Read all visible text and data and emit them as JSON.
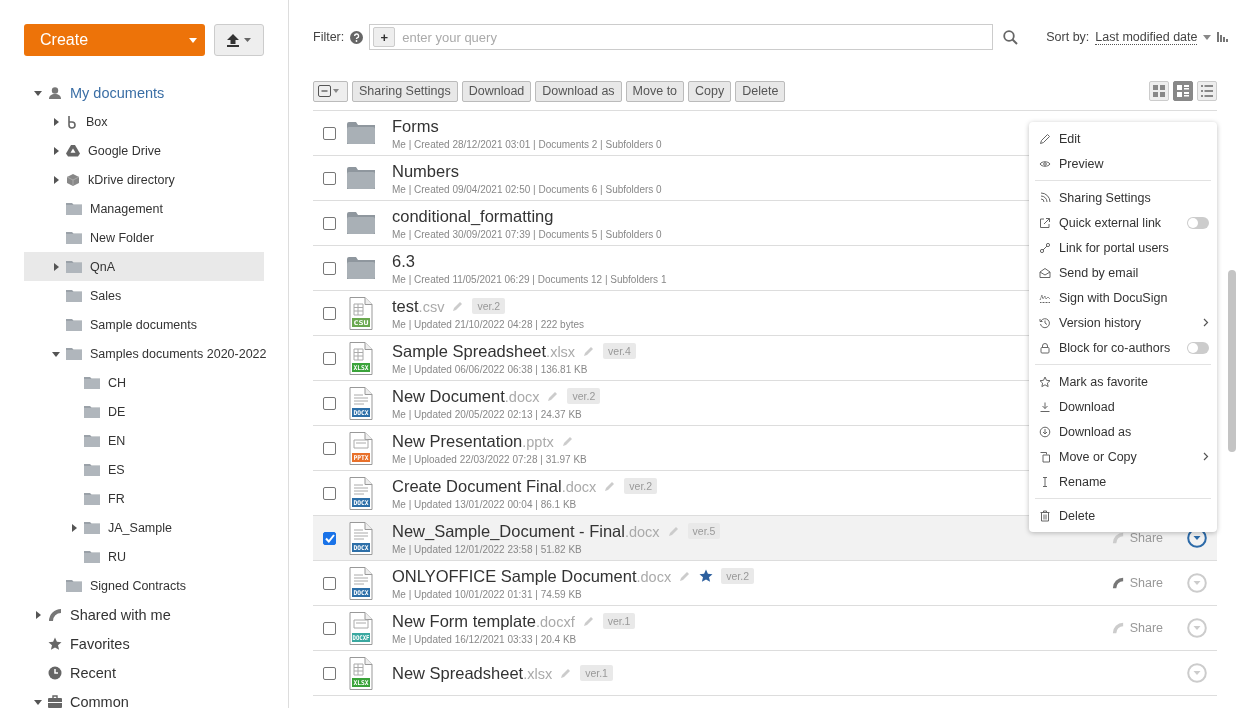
{
  "create_button": {
    "label": "Create"
  },
  "sidebar": {
    "tree": [
      {
        "label": "My documents",
        "kind": "user",
        "expanded": true,
        "selected": false,
        "children": [
          {
            "label": "Box",
            "kind": "box",
            "expanded": false,
            "selected": false
          },
          {
            "label": "Google Drive",
            "kind": "drive",
            "expanded": false,
            "selected": false
          },
          {
            "label": "kDrive directory",
            "kind": "cube",
            "expanded": false,
            "selected": false
          },
          {
            "label": "Management",
            "kind": "folder",
            "selected": false
          },
          {
            "label": "New Folder",
            "kind": "folder",
            "selected": false
          },
          {
            "label": "QnA",
            "kind": "folder",
            "expanded": false,
            "selected": true
          },
          {
            "label": "Sales",
            "kind": "folder",
            "selected": false
          },
          {
            "label": "Sample documents",
            "kind": "folder",
            "selected": false
          },
          {
            "label": "Samples documents 2020-2022",
            "kind": "folder",
            "expanded": true,
            "selected": false,
            "children": [
              {
                "label": "CH",
                "kind": "folder",
                "selected": false
              },
              {
                "label": "DE",
                "kind": "folder",
                "selected": false
              },
              {
                "label": "EN",
                "kind": "folder",
                "selected": false
              },
              {
                "label": "ES",
                "kind": "folder",
                "selected": false
              },
              {
                "label": "FR",
                "kind": "folder",
                "selected": false
              },
              {
                "label": "JA_Sample",
                "kind": "folder",
                "expanded": false,
                "selected": false
              },
              {
                "label": "RU",
                "kind": "folder",
                "selected": false
              }
            ]
          },
          {
            "label": "Signed Contracts",
            "kind": "folder",
            "selected": false
          }
        ]
      },
      {
        "label": "Shared with me",
        "kind": "shared",
        "expanded": false,
        "selected": false
      },
      {
        "label": "Favorites",
        "kind": "star",
        "selected": false
      },
      {
        "label": "Recent",
        "kind": "clock",
        "selected": false
      },
      {
        "label": "Common",
        "kind": "briefcase",
        "expanded": true,
        "selected": false
      }
    ]
  },
  "filter": {
    "label": "Filter:",
    "placeholder": "enter your query",
    "add": "+"
  },
  "sort": {
    "label": "Sort by:",
    "value": "Last modified date"
  },
  "toolbar": {
    "buttons": [
      "Sharing Settings",
      "Download",
      "Download as",
      "Move to",
      "Copy",
      "Delete"
    ]
  },
  "views": [
    {
      "kind": "tiles",
      "selected": false
    },
    {
      "kind": "compact",
      "selected": true
    },
    {
      "kind": "list",
      "selected": false
    }
  ],
  "files": [
    {
      "kind": "folder",
      "name": "Forms",
      "meta": "Me | Created 28/12/2021 03:01 | Documents 2 | Subfolders 0",
      "checked": false,
      "selected": false
    },
    {
      "kind": "folder",
      "name": "Numbers",
      "meta": "Me | Created 09/04/2021 02:50 | Documents 6 | Subfolders 0",
      "checked": false,
      "selected": false
    },
    {
      "kind": "folder",
      "name": "conditional_formatting",
      "meta": "Me | Created 30/09/2021 07:39 | Documents 5 | Subfolders 0",
      "checked": false,
      "selected": false
    },
    {
      "kind": "folder",
      "name": "6.3",
      "meta": "Me | Created 11/05/2021 06:29 | Documents 12 | Subfolders 1",
      "checked": false,
      "selected": false
    },
    {
      "kind": "csv",
      "badge": "CSU",
      "name": "test",
      "ext": ".csv",
      "version": "ver.2",
      "meta": "Me | Updated 21/10/2022 04:28 | 222 bytes",
      "checked": false,
      "selected": false
    },
    {
      "kind": "xlsx",
      "badge": "XLSX",
      "name": "Sample Spreadsheet",
      "ext": ".xlsx",
      "version": "ver.4",
      "meta": "Me | Updated 06/06/2022 06:38 | 136.81 KB",
      "checked": false,
      "selected": false
    },
    {
      "kind": "docx",
      "badge": "DOCX",
      "name": "New Document",
      "ext": ".docx",
      "version": "ver.2",
      "meta": "Me | Updated 20/05/2022 02:13 | 24.37 KB",
      "checked": false,
      "selected": false
    },
    {
      "kind": "pptx",
      "badge": "PPTX",
      "name": "New Presentation",
      "ext": ".pptx",
      "meta": "Me | Uploaded 22/03/2022 07:28 | 31.97 KB",
      "checked": false,
      "selected": false
    },
    {
      "kind": "docx",
      "badge": "DOCX",
      "name": "Create Document Final",
      "ext": ".docx",
      "version": "ver.2",
      "meta": "Me | Updated 13/01/2022 00:04 | 86.1 KB",
      "checked": false,
      "selected": false
    },
    {
      "kind": "docx",
      "badge": "DOCX",
      "name": "New_Sample_Document - Final",
      "ext": ".docx",
      "version": "ver.5",
      "meta": "Me | Updated 12/01/2022 23:58 | 51.82 KB",
      "checked": true,
      "selected": true,
      "share": "Share",
      "shared": false,
      "menu_open": true
    },
    {
      "kind": "docx",
      "badge": "DOCX",
      "name": "ONLYOFFICE Sample Document",
      "ext": ".docx",
      "favorite": true,
      "version": "ver.2",
      "meta": "Me | Updated 10/01/2022 01:31 | 74.59 KB",
      "checked": false,
      "selected": false,
      "share": "Share",
      "shared": true,
      "menu_open": false
    },
    {
      "kind": "docxf",
      "badge": "DOCXF",
      "name": "New Form template",
      "ext": ".docxf",
      "version": "ver.1",
      "meta": "Me | Updated 16/12/2021 03:33 | 20.4 KB",
      "checked": false,
      "selected": false,
      "share": "Share",
      "shared": false,
      "menu_open": false
    },
    {
      "kind": "xlsx",
      "badge": "XLSX",
      "name": "New Spreadsheet",
      "ext": ".xlsx",
      "version": "ver.1",
      "checked": false,
      "selected": false,
      "menu_open": false
    }
  ],
  "context_menu": [
    {
      "kind": "item",
      "label": "Edit"
    },
    {
      "kind": "item",
      "label": "Preview"
    },
    {
      "kind": "divider"
    },
    {
      "kind": "item",
      "label": "Sharing Settings"
    },
    {
      "kind": "toggle",
      "label": "Quick external link",
      "on": false
    },
    {
      "kind": "item",
      "label": "Link for portal users"
    },
    {
      "kind": "item",
      "label": "Send by email"
    },
    {
      "kind": "item",
      "label": "Sign with DocuSign"
    },
    {
      "kind": "submenu",
      "label": "Version history"
    },
    {
      "kind": "toggle",
      "label": "Block for co-authors",
      "on": false
    },
    {
      "kind": "divider"
    },
    {
      "kind": "item",
      "label": "Mark as favorite"
    },
    {
      "kind": "item",
      "label": "Download"
    },
    {
      "kind": "item",
      "label": "Download as"
    },
    {
      "kind": "submenu",
      "label": "Move or Copy"
    },
    {
      "kind": "item",
      "label": "Rename"
    },
    {
      "kind": "divider"
    },
    {
      "kind": "item",
      "label": "Delete"
    }
  ]
}
